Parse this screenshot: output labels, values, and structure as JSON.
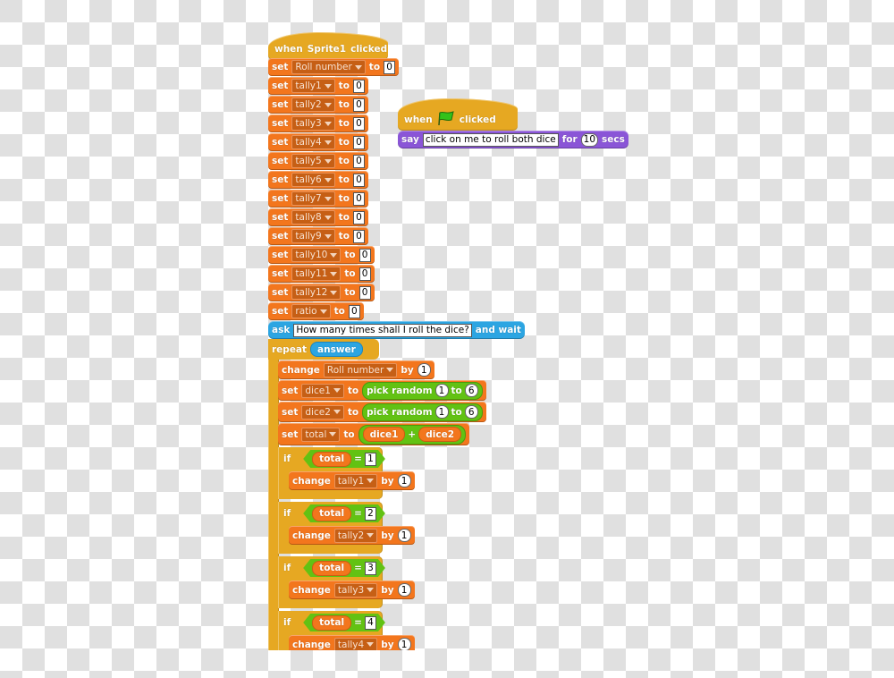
{
  "background": "transparency-checkerboard",
  "colors": {
    "variables": "#f3761d",
    "looks": "#8a55d7",
    "sensing": "#2ca5e2",
    "control": "#e6a822",
    "operators": "#62c213"
  },
  "script_main": {
    "hat": {
      "when": "when",
      "sprite": "Sprite1",
      "clicked": "clicked"
    },
    "set_kw": "set",
    "to_kw": "to",
    "sets": [
      {
        "var": "Roll number",
        "value": "0"
      },
      {
        "var": "tally1",
        "value": "0"
      },
      {
        "var": "tally2",
        "value": "0"
      },
      {
        "var": "tally3",
        "value": "0"
      },
      {
        "var": "tally4",
        "value": "0"
      },
      {
        "var": "tally5",
        "value": "0"
      },
      {
        "var": "tally6",
        "value": "0"
      },
      {
        "var": "tally7",
        "value": "0"
      },
      {
        "var": "tally8",
        "value": "0"
      },
      {
        "var": "tally9",
        "value": "0"
      },
      {
        "var": "tally10",
        "value": "0"
      },
      {
        "var": "tally11",
        "value": "0"
      },
      {
        "var": "tally12",
        "value": "0"
      },
      {
        "var": "ratio",
        "value": "0"
      }
    ],
    "ask": {
      "kw": "ask",
      "question": "How many times shall I roll the dice?",
      "suffix": "and wait"
    },
    "repeat": {
      "kw": "repeat",
      "count": "answer"
    },
    "change_roll": {
      "kw": "change",
      "var": "Roll number",
      "by": "by",
      "value": "1"
    },
    "set_dice1": {
      "kw": "set",
      "var": "dice1",
      "to": "to",
      "op": "pick random",
      "from": "1",
      "op_to": "to",
      "max": "6"
    },
    "set_dice2": {
      "kw": "set",
      "var": "dice2",
      "to": "to",
      "op": "pick random",
      "from": "1",
      "op_to": "to",
      "max": "6"
    },
    "set_total": {
      "kw": "set",
      "var": "total",
      "to": "to",
      "left": "dice1",
      "plus": "+",
      "right": "dice2"
    },
    "ifs": [
      {
        "kw": "if",
        "var": "total",
        "eq": "=",
        "value": "1",
        "change": "change",
        "target": "tally1",
        "by": "by",
        "inc": "1"
      },
      {
        "kw": "if",
        "var": "total",
        "eq": "=",
        "value": "2",
        "change": "change",
        "target": "tally2",
        "by": "by",
        "inc": "1"
      },
      {
        "kw": "if",
        "var": "total",
        "eq": "=",
        "value": "3",
        "change": "change",
        "target": "tally3",
        "by": "by",
        "inc": "1"
      },
      {
        "kw": "if",
        "var": "total",
        "eq": "=",
        "value": "4",
        "change": "change",
        "target": "tally4",
        "by": "by",
        "inc": "1"
      }
    ]
  },
  "script_flag": {
    "hat": {
      "when": "when",
      "icon": "green-flag-icon",
      "clicked": "clicked"
    },
    "say": {
      "kw": "say",
      "message": "click on me to roll both dice",
      "for": "for",
      "secs_value": "10",
      "secs": "secs"
    }
  }
}
